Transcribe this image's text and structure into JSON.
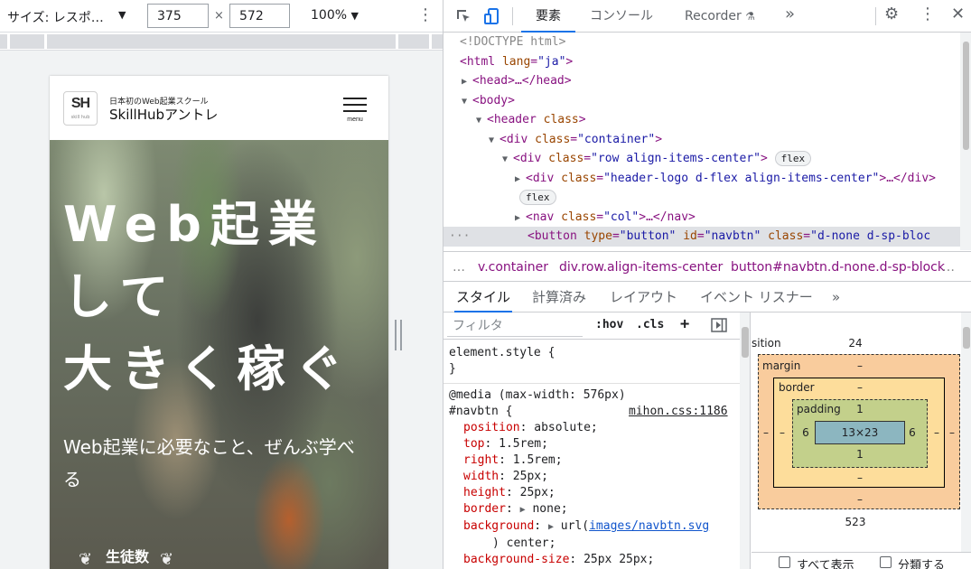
{
  "device_toolbar": {
    "size_label": "サイズ: レスポ…",
    "width": "375",
    "height": "572",
    "times": "×",
    "zoom": "100%"
  },
  "site": {
    "logo_text": "SH",
    "logo_sub": "skill hub",
    "tagline": "日本初のWeb起業スクール",
    "name": "SkillHubアントレ",
    "menu_label": "menu",
    "hero_title_1": "Web起業",
    "hero_title_2": "して",
    "hero_title_3": "大きく稼ぐ",
    "hero_sub": "Web起業に必要なこと、ぜんぶ学べる",
    "badge": "生徒数"
  },
  "devtools": {
    "tabs": [
      "要素",
      "コンソール",
      "Recorder"
    ],
    "active_tab": "要素",
    "dom": {
      "doctype": "<!DOCTYPE html>",
      "html_tag": "html",
      "html_attr": "lang",
      "html_val": "\"ja\"",
      "head": "<head>…</head>",
      "body": "<body>",
      "header_tag": "header",
      "header_attr": "class",
      "container_tag": "div",
      "container_attr": "class",
      "container_val": "\"container\"",
      "row_tag": "div",
      "row_attr": "class",
      "row_val": "\"row align-items-center\"",
      "row_pill": "flex",
      "logo_tag": "div",
      "logo_attr": "class",
      "logo_val": "\"header-logo d-flex align-items-center\"",
      "logo_close": "…</div>",
      "logo_pill": "flex",
      "nav_tag": "nav",
      "nav_attr": "class",
      "nav_val": "\"col\"",
      "nav_close": "…</nav>",
      "btn_tag": "button",
      "btn_attr1": "type",
      "btn_val1": "\"button\"",
      "btn_attr2": "id",
      "btn_val2": "\"navbtn\"",
      "btn_attr3": "class",
      "btn_val3": "\"d-none d-sp-bloc"
    },
    "breadcrumbs": [
      "v.container",
      "div.row.align-items-center",
      "button#navbtn.d-none.d-sp-block"
    ],
    "sub_tabs": [
      "スタイル",
      "計算済み",
      "レイアウト",
      "イベント リスナー"
    ],
    "active_sub_tab": "スタイル",
    "filter_placeholder": "フィルタ",
    "hov": ":hov",
    "cls": ".cls",
    "styles": {
      "element_style": "element.style {",
      "close": "}",
      "media": "@media (max-width: 576px)",
      "selector": "#navbtn {",
      "source": "mihon.css:1186",
      "props": [
        {
          "name": "position",
          "value": "absolute;"
        },
        {
          "name": "top",
          "value": "1.5rem;"
        },
        {
          "name": "right",
          "value": "1.5rem;"
        },
        {
          "name": "width",
          "value": "25px;"
        },
        {
          "name": "height",
          "value": "25px;"
        },
        {
          "name": "border",
          "value": "none;"
        },
        {
          "name": "background",
          "value": "url(images/navbtn.svg) center;"
        },
        {
          "name": "background-size",
          "value": "25px 25px;"
        }
      ],
      "bg_url": "images/navbtn.svg",
      "bg_rest": ") center;",
      "bg_prefix": "url("
    },
    "box_model": {
      "position_label": "sition",
      "position_top": "24",
      "position_bottom": "523",
      "margin_label": "margin",
      "margin_top": "–",
      "margin_bottom": "–",
      "margin_left": "–",
      "margin_right": "–",
      "border_label": "border",
      "border_top": "–",
      "border_bottom": "–",
      "border_left": "–",
      "border_right": "–",
      "padding_label": "padding",
      "padding_top": "1",
      "padding_bottom": "1",
      "padding_left": "6",
      "padding_right": "6",
      "content": "13×23",
      "show_all": "すべて表示",
      "group": "分類する"
    }
  },
  "colors": {
    "accent": "#1a73e8",
    "tag": "#881280",
    "attr": "#994500",
    "value": "#1a1aa6"
  }
}
